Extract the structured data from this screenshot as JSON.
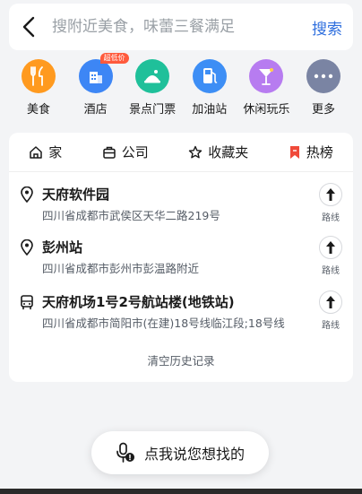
{
  "search": {
    "placeholder": "搜附近美食，味蕾三餐满足",
    "button_label": "搜索"
  },
  "categories": [
    {
      "label": "美食",
      "icon": "food-icon",
      "color": "#ff9a1f"
    },
    {
      "label": "酒店",
      "icon": "hotel-icon",
      "color": "#3d86f5",
      "badge": "超低价"
    },
    {
      "label": "景点门票",
      "icon": "scenic-ticket-icon",
      "color": "#1fc09a"
    },
    {
      "label": "加油站",
      "icon": "gas-station-icon",
      "color": "#3d8ef5"
    },
    {
      "label": "休闲玩乐",
      "icon": "leisure-icon",
      "color": "#b77cf0"
    },
    {
      "label": "更多",
      "icon": "more-icon",
      "color": "#7a84a3"
    }
  ],
  "quick_links": [
    {
      "label": "家",
      "icon": "home-icon"
    },
    {
      "label": "公司",
      "icon": "briefcase-icon"
    },
    {
      "label": "收藏夹",
      "icon": "star-icon"
    },
    {
      "label": "热榜",
      "icon": "bookmark-icon",
      "color": "#f04a3a"
    }
  ],
  "history": [
    {
      "title": "天府软件园",
      "address": "四川省成都市武侯区天华二路219号",
      "icon": "location-pin-icon",
      "route_label": "路线"
    },
    {
      "title": "彭州站",
      "address": "四川省成都市彭州市彭温路附近",
      "icon": "location-pin-icon",
      "route_label": "路线"
    },
    {
      "title": "天府机场1号2号航站楼(地铁站)",
      "address": "四川省成都市简阳市(在建)18号线临江段;18号线",
      "icon": "bus-icon",
      "route_label": "路线"
    }
  ],
  "clear_history_label": "清空历史记录",
  "voice": {
    "label": "点我说您想找的",
    "icon": "microphone-icon"
  },
  "colors": {
    "accent": "#2f6fde",
    "background": "#f3f4f6",
    "card": "#ffffff"
  }
}
